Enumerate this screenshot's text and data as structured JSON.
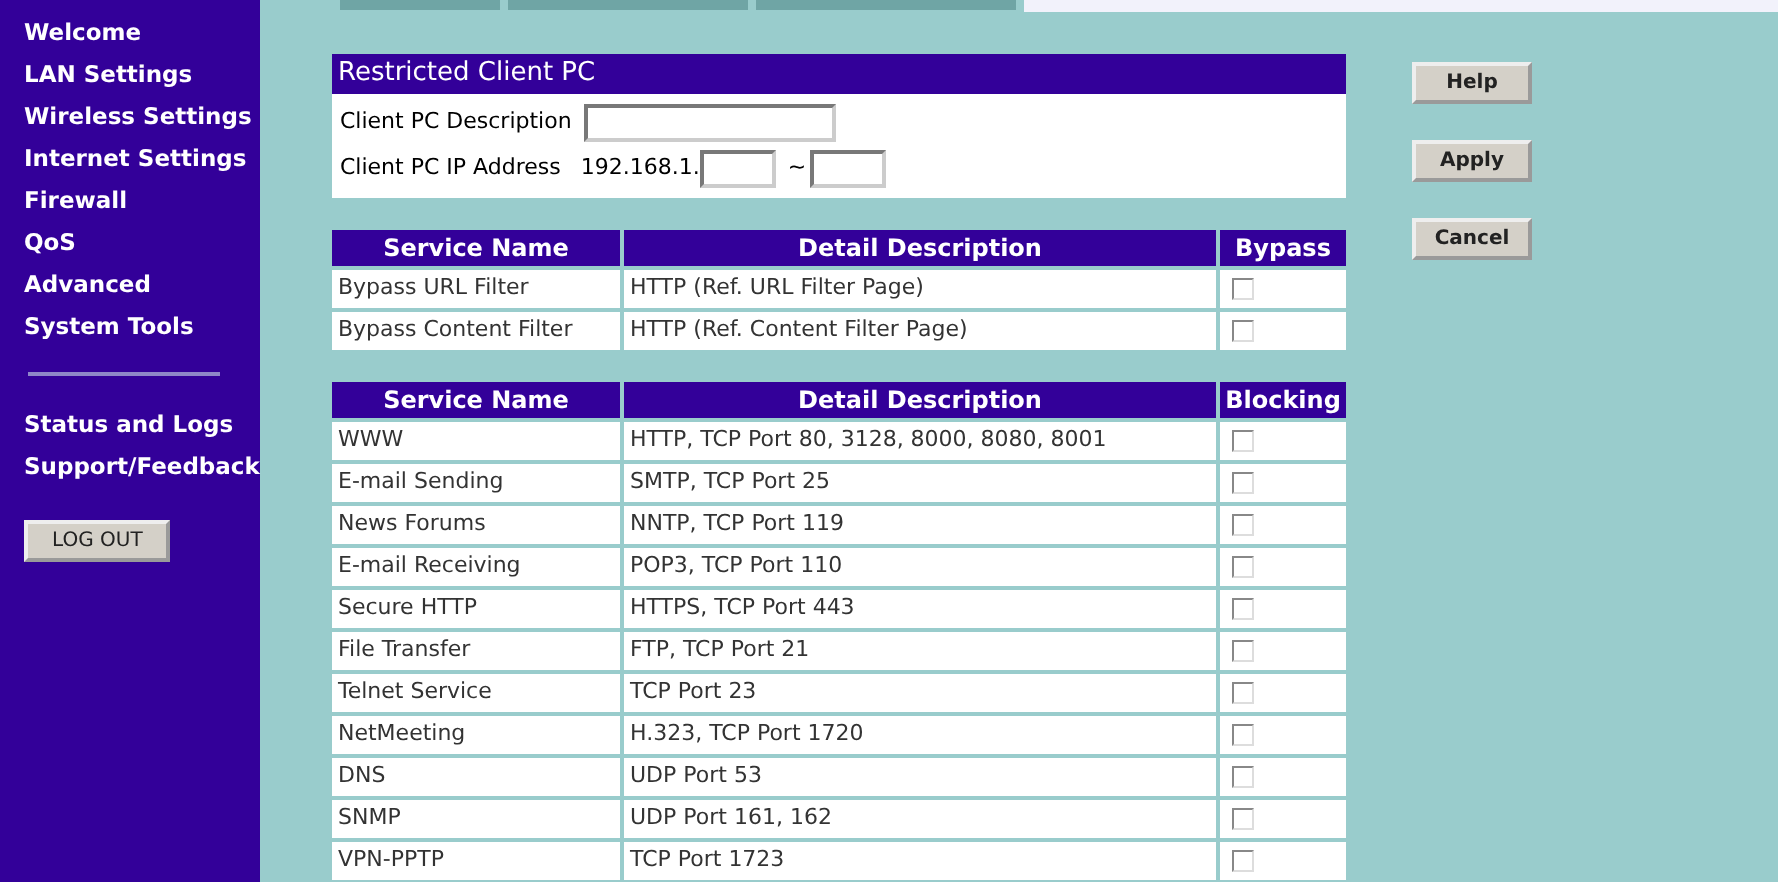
{
  "sidebar": {
    "main_items": [
      {
        "label": "Welcome"
      },
      {
        "label": "LAN Settings"
      },
      {
        "label": "Wireless Settings"
      },
      {
        "label": "Internet Settings"
      },
      {
        "label": "Firewall"
      },
      {
        "label": "QoS"
      },
      {
        "label": "Advanced"
      },
      {
        "label": "System Tools"
      }
    ],
    "secondary_items": [
      {
        "label": "Status and Logs"
      },
      {
        "label": "Support/Feedback"
      }
    ],
    "logout_button": "LOG OUT"
  },
  "restricted_client": {
    "title": "Restricted Client PC",
    "description_label": "Client PC Description",
    "ip_label": "Client PC IP Address",
    "ip_prefix": "192.168.1.",
    "range_separator": "~"
  },
  "bypass_table": {
    "columns": [
      "Service Name",
      "Detail Description",
      "Bypass"
    ],
    "rows": [
      {
        "service": "Bypass URL Filter",
        "detail": "HTTP (Ref. URL Filter Page)",
        "checked": false
      },
      {
        "service": "Bypass Content Filter",
        "detail": "HTTP (Ref. Content Filter Page)",
        "checked": false
      }
    ]
  },
  "blocking_table": {
    "columns": [
      "Service Name",
      "Detail Description",
      "Blocking"
    ],
    "rows": [
      {
        "service": "WWW",
        "detail": "HTTP, TCP Port 80, 3128, 8000, 8080, 8001",
        "checked": false
      },
      {
        "service": "E-mail Sending",
        "detail": "SMTP, TCP Port 25",
        "checked": false
      },
      {
        "service": "News Forums",
        "detail": "NNTP, TCP Port 119",
        "checked": false
      },
      {
        "service": "E-mail Receiving",
        "detail": "POP3, TCP Port 110",
        "checked": false
      },
      {
        "service": "Secure HTTP",
        "detail": "HTTPS, TCP Port 443",
        "checked": false
      },
      {
        "service": "File Transfer",
        "detail": "FTP, TCP Port 21",
        "checked": false
      },
      {
        "service": "Telnet Service",
        "detail": "TCP Port 23",
        "checked": false
      },
      {
        "service": "NetMeeting",
        "detail": "H.323, TCP Port 1720",
        "checked": false
      },
      {
        "service": "DNS",
        "detail": "UDP Port 53",
        "checked": false
      },
      {
        "service": "SNMP",
        "detail": "UDP Port 161, 162",
        "checked": false
      },
      {
        "service": "VPN-PPTP",
        "detail": "TCP Port 1723",
        "checked": false
      }
    ]
  },
  "buttons": [
    "Help",
    "Apply",
    "Cancel"
  ]
}
